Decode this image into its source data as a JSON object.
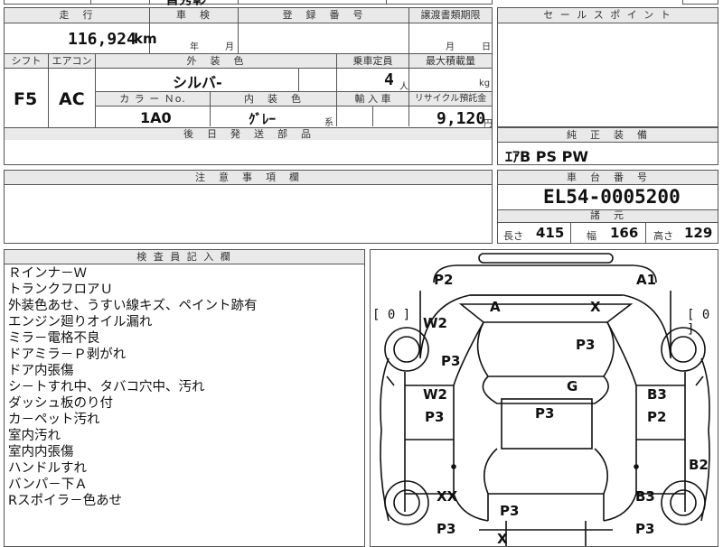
{
  "top_strip": {
    "partial_text": "盲秀彰"
  },
  "mileage": {
    "header": "走　行",
    "value": "116,924",
    "unit": "km"
  },
  "inspection": {
    "header": "車　検",
    "year_unit": "年",
    "month_unit": "月"
  },
  "registration": {
    "header": "登　録　番　号"
  },
  "transfer_deadline": {
    "header": "譲渡書類期限",
    "month_unit": "月",
    "day_unit": "日"
  },
  "shift": {
    "header": "シフト",
    "value": "F5"
  },
  "aircon": {
    "header": "エアコン",
    "value": "AC"
  },
  "exterior_color": {
    "header": "外　装　色",
    "value": "シルバ-"
  },
  "capacity": {
    "header": "乗車定員",
    "value": "4",
    "unit": "人"
  },
  "max_load": {
    "header": "最大積載量",
    "unit": "kg"
  },
  "color_no": {
    "header": "カ ラ ー Ｎo.",
    "value": "1A0"
  },
  "interior_color": {
    "header": "内　装　色",
    "value": "ｸﾞﾚｰ",
    "suffix": "系"
  },
  "import": {
    "header": "輸 入 車"
  },
  "recycle": {
    "header": "リサイクル預託金",
    "value": "9,120",
    "unit": "円"
  },
  "later_parts": {
    "header": "後　日　発　送　部　品"
  },
  "sales_point": {
    "header": "セ ー ル ス ポ イ ン ト"
  },
  "genuine_equipment": {
    "header": "純　正　装　備",
    "value": "ｴｱB PS PW"
  },
  "caution": {
    "header": "注　意　事　項　欄"
  },
  "chassis": {
    "header": "車　台　番　号",
    "value": "EL54-0005200"
  },
  "specs": {
    "header": "諸　元",
    "length_label": "長さ",
    "length": "415",
    "width_label": "幅",
    "width": "166",
    "height_label": "高さ",
    "height": "129"
  },
  "inspector_notes": {
    "header": "検 査 員 記 入 欄",
    "lines": [
      "Ｒインナ－Ｗ",
      "トランクフロアＵ",
      "外装色あせ、うすい線キズ、ペイント跡有",
      "エンジン廻りオイル漏れ",
      "ミラ－電格不良",
      "ドアミラ－Ｐ剥がれ",
      "ドア内張傷",
      "シ－トすれ中、タバコ穴中、汚れ",
      "ダッシュ板のり付",
      "カ－ペット汚れ",
      "室内汚れ",
      "室内内張傷",
      "ハンドルすれ",
      "バンパ－下Ａ",
      "Rスポイラ－色あせ"
    ]
  },
  "diagram": {
    "bracket_left": "[ 0 ]",
    "bracket_right": "[ 0 ]",
    "marks": {
      "p2_top": "P2",
      "a1_top": "A1",
      "a_windshield": "A",
      "x_windshield": "X",
      "w2_left_upper": "W2",
      "p3_hood": "P3",
      "p3_left_fender": "P3",
      "g_roof": "G",
      "w2_left_mid": "W2",
      "b3_right_mid": "B3",
      "p3_left_door": "P3",
      "p3_center": "P3",
      "p2_right_door": "P2",
      "b2_right": "B2",
      "xx_left_rear": "XX",
      "b3_right_rear": "B3",
      "p3_trunk": "P3",
      "p3_left_bottom": "P3",
      "p3_right_bottom": "P3",
      "x_bottom": "X"
    }
  }
}
